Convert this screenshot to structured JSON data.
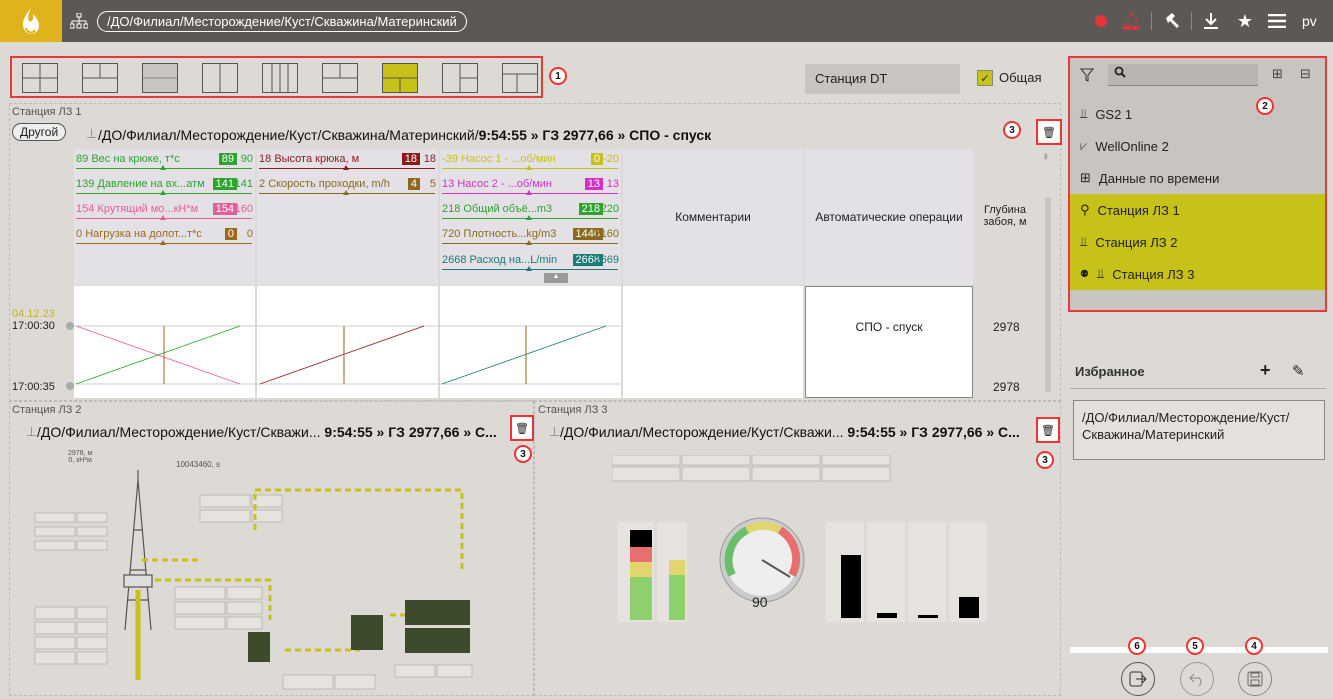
{
  "header": {
    "breadcrumb": "/ДО/Филиал/Месторождение/Куст/Скважина/Материнский",
    "user": "pv"
  },
  "toolbar": {
    "station": "Станция DT",
    "general_label": "Общая",
    "markers": [
      "1",
      "2",
      "3",
      "4",
      "5",
      "6"
    ]
  },
  "panel1": {
    "label": "Станция ЛЗ 1",
    "other_btn": "Другой",
    "path": "/ДО/Филиал/Месторождение/Куст/Скважина/Материнский/",
    "status": "9:54:55 » ГЗ 2977,66 » СПО - спуск",
    "params": [
      {
        "min": "89",
        "name": "Вес на крюке, т*с",
        "val": "89",
        "max": "90",
        "color": "#2da42d"
      },
      {
        "min": "139",
        "name": "Давление на вх...атм",
        "val": "141",
        "max": "141",
        "color": "#2da42d"
      },
      {
        "min": "154",
        "name": "Крутящий мо...кН*м",
        "val": "154",
        "max": "160",
        "color": "#e45d9b"
      },
      {
        "min": "0",
        "name": "Нагрузка на долот...т*с",
        "val": "0",
        "max": "0",
        "color": "#9b6a1c"
      },
      {
        "min": "18",
        "name": "Высота крюка, м",
        "val": "18",
        "max": "18",
        "color": "#8a1c1c"
      },
      {
        "min": "2",
        "name": "Скорость проходки, m/h",
        "val": "4",
        "max": "5",
        "color": "#8a6a1c"
      },
      {
        "min": "-39",
        "name": "Насос 1 - ...об/мин",
        "val": "0",
        "max": "-20",
        "color": "#c6c11a"
      },
      {
        "min": "13",
        "name": "Насос 2 - ...об/мин",
        "val": "13",
        "max": "13",
        "color": "#d32fc9"
      },
      {
        "min": "218",
        "name": "Общий объё...m3",
        "val": "218",
        "max": "220",
        "color": "#2da42d"
      },
      {
        "min": "720",
        "name": "Плотность...kg/m3",
        "val": "1440",
        "max": "2160",
        "color": "#8a6a1c"
      },
      {
        "min": "2668",
        "name": "Расход на...L/min",
        "val": "2668",
        "max": "2669",
        "color": "#1c7a7a"
      }
    ],
    "col_comments": "Комментарии",
    "col_auto": "Автоматические операции",
    "col_depth": "Глубина забоя, м",
    "date": "04.12.23",
    "t1": "17:00:30",
    "t2": "17:00:35",
    "op": "СПО - спуск",
    "depth1": "2978",
    "depth2": "2978"
  },
  "panel2": {
    "label": "Станция ЛЗ 2",
    "path": "/ДО/Филиал/Месторождение/Куст/Скважи...",
    "status": "9:54:55 » ГЗ 2977,66 » С..."
  },
  "panel3": {
    "label": "Станция ЛЗ 3",
    "path": "/ДО/Филиал/Месторождение/Куст/Скважи...",
    "status": "9:54:55 » ГЗ 2977,66 » С...",
    "gauge": "90"
  },
  "tree": {
    "search_placeholder": "",
    "items": [
      {
        "label": "GS2 1"
      },
      {
        "label": "WellOnline 2"
      },
      {
        "label": "Данные по времени"
      },
      {
        "label": "Станция ЛЗ 1"
      },
      {
        "label": "Станция ЛЗ 2"
      },
      {
        "label": "Станция ЛЗ 3"
      }
    ]
  },
  "favorites": {
    "title": "Избранное",
    "path": "/ДО/Филиал/Месторождение/Куст/Скважина/Материнский"
  }
}
